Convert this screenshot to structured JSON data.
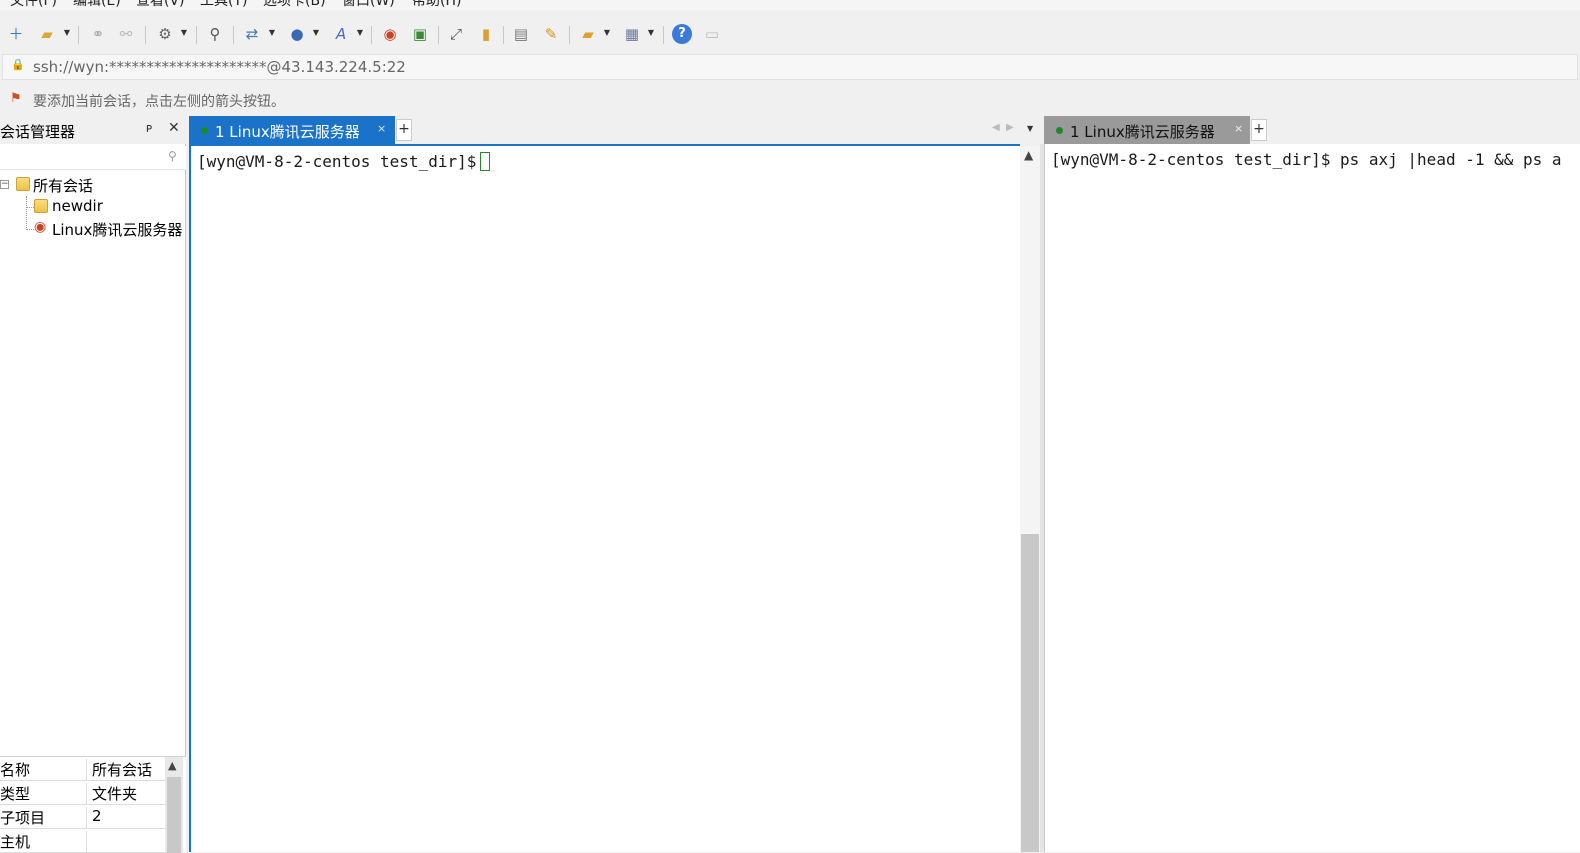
{
  "menu": [
    "文件(F)",
    "编辑(E)",
    "查看(V)",
    "工具(T)",
    "选项卡(B)",
    "窗口(W)",
    "帮助(H)"
  ],
  "toolbar": {
    "icons": [
      "new-session-icon",
      "open-folder-icon",
      "connect-icon",
      "disconnect-icon",
      "settings-icon",
      "search-icon",
      "transfer-icon",
      "globe-icon",
      "font-icon",
      "xshell-icon",
      "xftp-icon",
      "fullscreen-icon",
      "lock-icon",
      "keyboard-icon",
      "highlight-icon",
      "new-tab-folder-icon",
      "layout-icon",
      "help-icon",
      "chat-icon"
    ]
  },
  "address": {
    "text": "ssh://wyn:*********************@43.143.224.5:22"
  },
  "hint": {
    "text": "要添加当前会话，点击左侧的箭头按钮。"
  },
  "session_manager": {
    "title": "会话管理器",
    "pin": "ᵽ",
    "close": "✕",
    "tree": {
      "root": "所有会话",
      "children": [
        "newdir",
        "Linux腾讯云服务器"
      ]
    },
    "properties": [
      {
        "key": "名称",
        "value": "所有会话"
      },
      {
        "key": "类型",
        "value": "文件夹"
      },
      {
        "key": "子项目",
        "value": "2"
      },
      {
        "key": "主机",
        "value": ""
      }
    ]
  },
  "pane_left": {
    "tab_label": "1 Linux腾讯云服务器",
    "tab_close": "×",
    "add_tab": "+",
    "prompt": "[wyn@VM-8-2-centos test_dir]$"
  },
  "pane_right": {
    "tab_label": "1 Linux腾讯云服务器",
    "tab_close": "×",
    "add_tab": "+",
    "line": "[wyn@VM-8-2-centos test_dir]$ ps axj |head -1 && ps a"
  },
  "colors": {
    "active_tab": "#1a73c8",
    "inactive_tab": "#9a9a9a",
    "status_dot": "#1a8a2a"
  }
}
